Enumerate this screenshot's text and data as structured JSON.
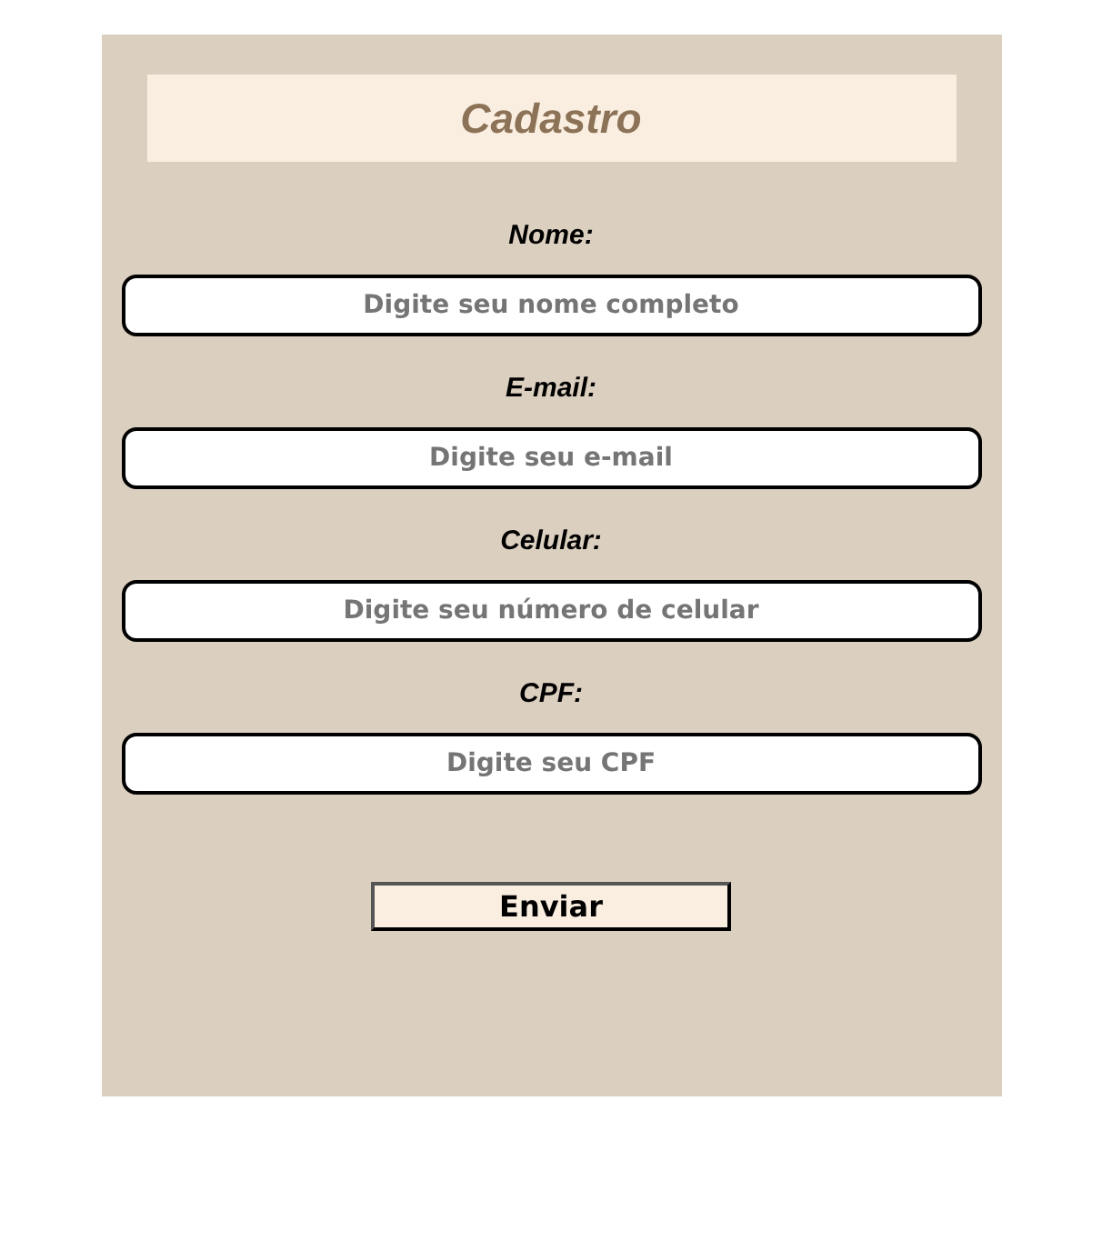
{
  "form": {
    "title": "Cadastro",
    "fields": [
      {
        "label": "Nome:",
        "placeholder": "Digite seu nome completo"
      },
      {
        "label": "E-mail:",
        "placeholder": "Digite seu e-mail"
      },
      {
        "label": "Celular:",
        "placeholder": "Digite seu número de celular"
      },
      {
        "label": "CPF:",
        "placeholder": "Digite seu CPF"
      }
    ],
    "submit": "Enviar"
  }
}
